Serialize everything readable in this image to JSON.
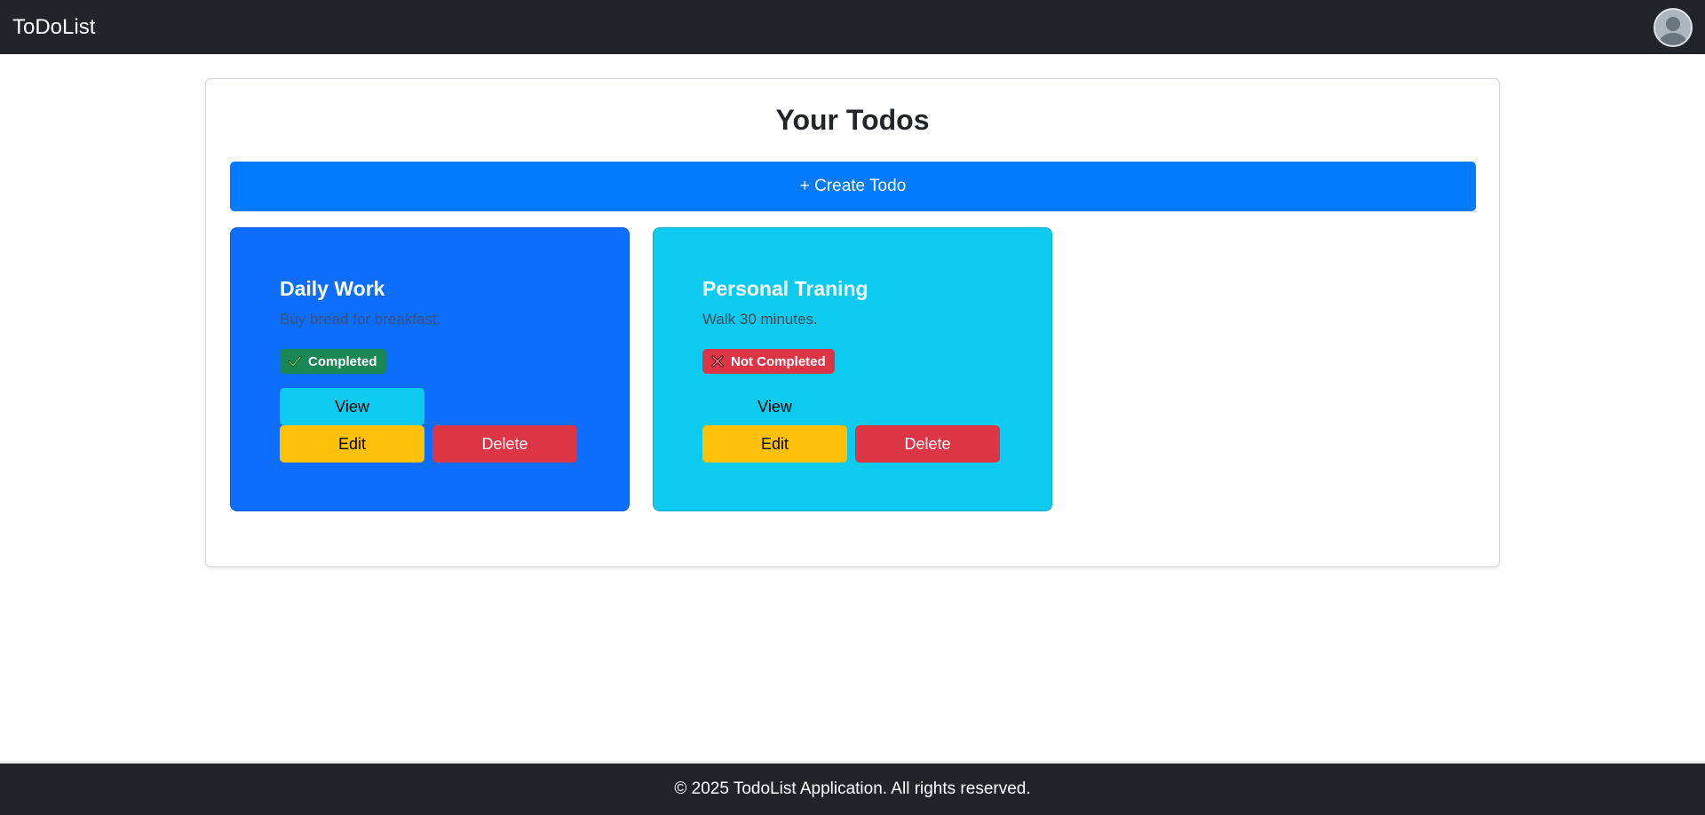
{
  "navbar": {
    "brand": "ToDoList",
    "avatar_icon": "user-avatar-icon"
  },
  "main": {
    "title": "Your Todos",
    "create_button_label": "+ Create Todo",
    "todos": [
      {
        "title": "Daily Work",
        "description": "Buy bread for breakfast.",
        "status_label": "Completed",
        "status_icon": "check-icon",
        "status_color": "#198754",
        "card_color": "#0d6efd",
        "view_label": "View",
        "edit_label": "Edit",
        "delete_label": "Delete"
      },
      {
        "title": "Personal Traning",
        "description": "Walk 30 minutes.",
        "status_label": "Not Completed",
        "status_icon": "x-icon",
        "status_color": "#dc3545",
        "card_color": "#0dcaf0",
        "view_label": "View",
        "edit_label": "Edit",
        "delete_label": "Delete"
      }
    ]
  },
  "footer": {
    "text": "© 2025 TodoList Application. All rights reserved."
  },
  "colors": {
    "navbar": "#212529",
    "primary": "#007bff",
    "warning": "#ffc107",
    "danger": "#dc3545",
    "info": "#0dcaf0",
    "success": "#198754"
  }
}
